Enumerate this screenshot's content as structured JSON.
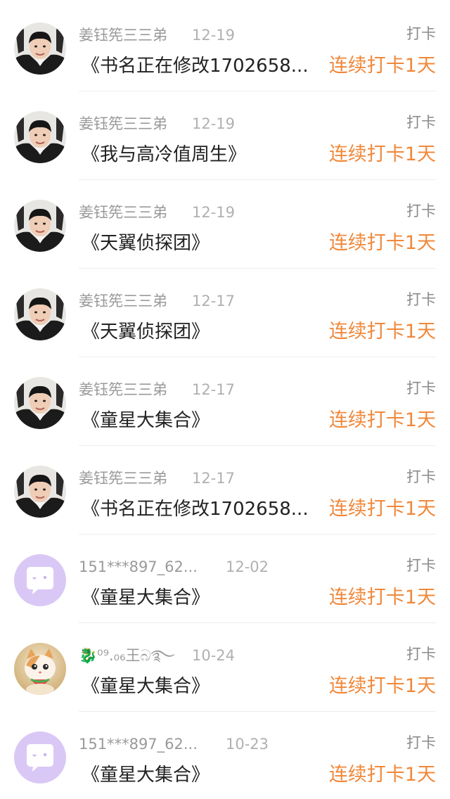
{
  "records": [
    {
      "avatar": "boy-photo",
      "name": "姜钰筅三三弟",
      "date": "12-19",
      "tag": "打卡",
      "book": "《书名正在修改1702658...",
      "streak": "连续打卡1天"
    },
    {
      "avatar": "boy-photo",
      "name": "姜钰筅三三弟",
      "date": "12-19",
      "tag": "打卡",
      "book": "《我与高冷值周生》",
      "streak": "连续打卡1天"
    },
    {
      "avatar": "boy-photo",
      "name": "姜钰筅三三弟",
      "date": "12-19",
      "tag": "打卡",
      "book": "《天翼侦探团》",
      "streak": "连续打卡1天"
    },
    {
      "avatar": "boy-photo",
      "name": "姜钰筅三三弟",
      "date": "12-17",
      "tag": "打卡",
      "book": "《天翼侦探团》",
      "streak": "连续打卡1天"
    },
    {
      "avatar": "boy-photo",
      "name": "姜钰筅三三弟",
      "date": "12-17",
      "tag": "打卡",
      "book": "《童星大集合》",
      "streak": "连续打卡1天"
    },
    {
      "avatar": "boy-photo",
      "name": "姜钰筅三三弟",
      "date": "12-17",
      "tag": "打卡",
      "book": "《书名正在修改1702658...",
      "streak": "连续打卡1天"
    },
    {
      "avatar": "default-chat-avatar",
      "name": "151***897_62...",
      "date": "12-02",
      "tag": "打卡",
      "book": "《童星大集合》",
      "streak": "连续打卡1天"
    },
    {
      "avatar": "kitten-photo",
      "name": "🐉⁰⁹.₀₆王බ࿐",
      "date": "10-24",
      "tag": "打卡",
      "book": "《童星大集合》",
      "streak": "连续打卡1天"
    },
    {
      "avatar": "default-chat-avatar",
      "name": "151***897_62...",
      "date": "10-23",
      "tag": "打卡",
      "book": "《童星大集合》",
      "streak": "连续打卡1天"
    }
  ],
  "colors": {
    "streak": "#f0883a",
    "name": "#9a9a9a",
    "book": "#222222",
    "default_avatar_bg": "#d9c8f5",
    "default_avatar_icon": "#ffffff"
  }
}
